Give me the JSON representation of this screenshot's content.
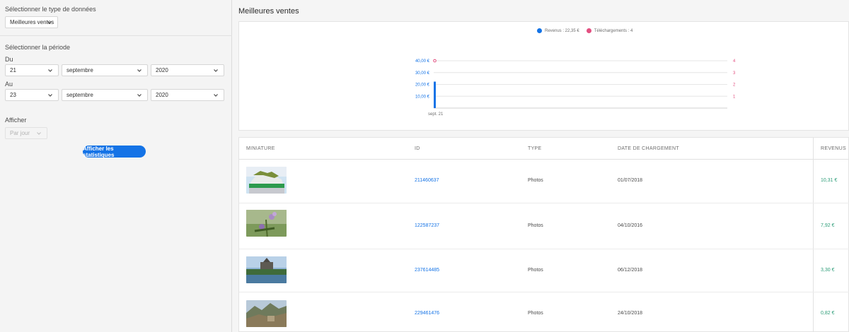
{
  "sidebar": {
    "data_type_label": "Sélectionner le type de données",
    "data_type_value": "Meilleures ventes",
    "period_label": "Sélectionner la période",
    "from_label": "Du",
    "from_day": "21",
    "from_month": "septembre",
    "from_year": "2020",
    "to_label": "Au",
    "to_day": "23",
    "to_month": "septembre",
    "to_year": "2020",
    "display_label": "Afficher",
    "display_value": "Par jour",
    "submit_label": "Afficher les statistiques"
  },
  "main": {
    "title": "Meilleures ventes"
  },
  "chart_data": {
    "type": "bar",
    "categories": [
      "sept. 21"
    ],
    "series": [
      {
        "name": "Revenus : 22,35 €",
        "values": [
          22.35
        ],
        "color": "#1473e6",
        "axis": "left"
      },
      {
        "name": "Téléchargements : 4",
        "values": [
          4
        ],
        "color": "#e34f80",
        "axis": "right"
      }
    ],
    "y_left_ticks": [
      "10,00 €",
      "20,00 €",
      "30,00 €",
      "40,00 €"
    ],
    "y_right_ticks": [
      "1",
      "2",
      "3",
      "4"
    ],
    "ylim_left": [
      0,
      40
    ],
    "ylim_right": [
      0,
      4
    ],
    "grid": true,
    "legend_position": "top-center"
  },
  "table": {
    "headers": {
      "thumb": "MINIATURE",
      "id": "ID",
      "type": "TYPE",
      "date": "DATE DE CHARGEMENT",
      "revenue": "REVENUS"
    },
    "rows": [
      {
        "id": "211460637",
        "type": "Photos",
        "date": "01/07/2018",
        "revenue": "10,31 €"
      },
      {
        "id": "122587237",
        "type": "Photos",
        "date": "04/10/2016",
        "revenue": "7,92 €"
      },
      {
        "id": "237614485",
        "type": "Photos",
        "date": "06/12/2018",
        "revenue": "3,30 €"
      },
      {
        "id": "229461476",
        "type": "Photos",
        "date": "24/10/2018",
        "revenue": "0,82 €"
      }
    ]
  },
  "colors": {
    "accent": "#1473e6",
    "downloads": "#e34f80",
    "revenue_text": "#2d9d78"
  }
}
